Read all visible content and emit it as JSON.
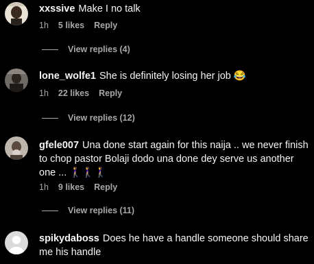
{
  "colors": {
    "background": "#000000",
    "text": "#f5f5f5",
    "muted": "#a8a8a8"
  },
  "comments": [
    {
      "username": "xxssive",
      "text": "Make I no talk",
      "time": "1h",
      "likes": "5 likes",
      "reply_label": "Reply",
      "view_replies": "View replies (4)"
    },
    {
      "username": "lone_wolfe1",
      "text": "She is definitely losing her job 😂",
      "time": "1h",
      "likes": "22 likes",
      "reply_label": "Reply",
      "view_replies": "View replies (12)"
    },
    {
      "username": "gfele007",
      "text": "Una done start again for this naija .. we never finish to chop pastor Bolaji dodo una done dey serve us another one ... 🚶‍♀️🚶‍♀️🚶‍♀️",
      "time": "1h",
      "likes": "9 likes",
      "reply_label": "Reply",
      "view_replies": "View replies (11)"
    },
    {
      "username": "spikydaboss",
      "text": "Does he have a handle someone should share me his handle"
    }
  ]
}
